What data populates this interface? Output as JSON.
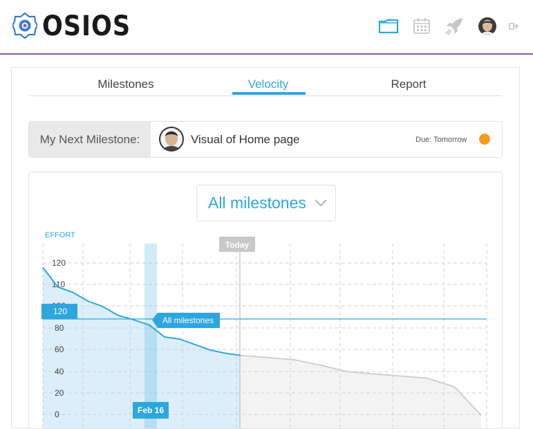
{
  "header": {
    "logo_text": "OSIOS",
    "icons": [
      "folder-icon",
      "calendar-icon",
      "rocket-icon",
      "user-avatar",
      "logout-icon"
    ]
  },
  "tabs": [
    {
      "label": "Milestones",
      "active": false
    },
    {
      "label": "Velocity",
      "active": true
    },
    {
      "label": "Report",
      "active": false
    }
  ],
  "next_milestone": {
    "label": "My Next Milestone:",
    "title": "Visual of Home page",
    "due": "Due: Tomorrow",
    "status_color": "#f39c1f"
  },
  "dropdown": {
    "selected": "All milestones"
  },
  "chart_data": {
    "type": "line",
    "ylabel": "EFFORT",
    "y_ticks": [
      0,
      20,
      40,
      60,
      80,
      100,
      110,
      120
    ],
    "today_label": "Today",
    "highlight_x_label": "Feb 16",
    "target_label": "120",
    "series_label": "All milestones",
    "series": [
      {
        "name": "All milestones",
        "kind": "actual",
        "color": "#2ea6de",
        "values": [
          136,
          118,
          113,
          105,
          100,
          92,
          88,
          83,
          72,
          70,
          65,
          60,
          57,
          55
        ]
      },
      {
        "name": "",
        "kind": "projection",
        "color": "#cfcfcf",
        "values": [
          55,
          53,
          51,
          46,
          40,
          38,
          36,
          34,
          26,
          0
        ]
      }
    ],
    "colors": {
      "accent": "#2ea6de",
      "fill": "#dbeefa",
      "today": "#c8c8c8",
      "projection_fill": "#f3f3f3"
    }
  }
}
